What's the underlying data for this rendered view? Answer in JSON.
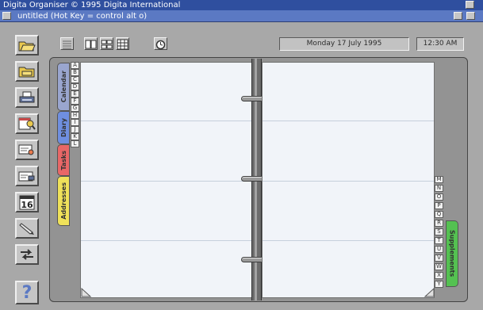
{
  "title_bar": {
    "text": "Digita Organiser  © 1995 Digita International"
  },
  "window": {
    "title": "untitled  (Hot Key = control alt o)"
  },
  "toolbar": {
    "date": "Monday 17 July 1995",
    "time": "12:30 AM"
  },
  "left_tools": [
    {
      "name": "open-folder-icon"
    },
    {
      "name": "save-folder-icon"
    },
    {
      "name": "printer-icon"
    },
    {
      "name": "calendar-search-icon"
    },
    {
      "name": "card-search-icon"
    },
    {
      "name": "card-edit-icon"
    },
    {
      "name": "calendar-day-icon",
      "label": "16"
    },
    {
      "name": "pen-icon"
    },
    {
      "name": "transfer-arrows-icon"
    },
    {
      "name": "help-icon",
      "label": "?"
    }
  ],
  "section_tabs": {
    "calendar": "Calendar",
    "diary": "Diary",
    "tasks": "Tasks",
    "addresses": "Addresses",
    "supplements": "Supplements"
  },
  "colors": {
    "calendar_tab": "#9aa6cf",
    "diary_tab": "#6f8fe0",
    "tasks_tab": "#e86767",
    "addresses_tab": "#efe15a",
    "supplements_tab": "#54c151"
  },
  "alphabet_left": [
    "A",
    "B",
    "C",
    "D",
    "E",
    "F",
    "G",
    "H",
    "I",
    "J",
    "K",
    "L"
  ],
  "alphabet_right": [
    "M",
    "N",
    "O",
    "P",
    "Q",
    "R",
    "S",
    "T",
    "U",
    "V",
    "W",
    "X",
    "Y"
  ]
}
